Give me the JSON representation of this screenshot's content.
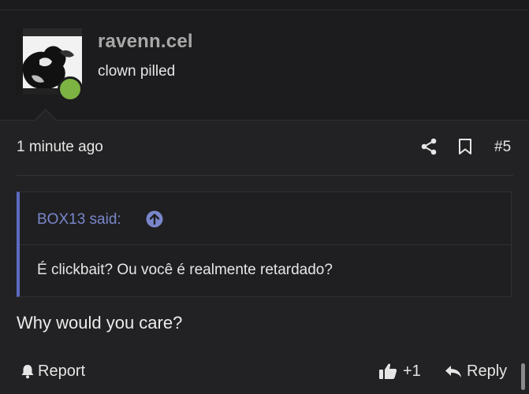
{
  "author": {
    "username": "ravenn.cel",
    "title": "clown pilled",
    "online_color": "#7cb342"
  },
  "post": {
    "timestamp": "1 minute ago",
    "number": "#5",
    "icons": {
      "share": "share-icon",
      "bookmark": "bookmark-icon"
    },
    "quote": {
      "author_line": "BOX13 said:",
      "jump_icon": "arrow-up-circle-icon",
      "text": "É clickbait? Ou você é realmente retardado?"
    },
    "message": "Why would you care?"
  },
  "actions": {
    "report_label": "Report",
    "like_label": "+1",
    "reply_label": "Reply"
  },
  "colors": {
    "background": "#222224",
    "header_background": "#1c1c1e",
    "quote_accent": "#5c6bc0",
    "quote_author": "#7986cb"
  }
}
